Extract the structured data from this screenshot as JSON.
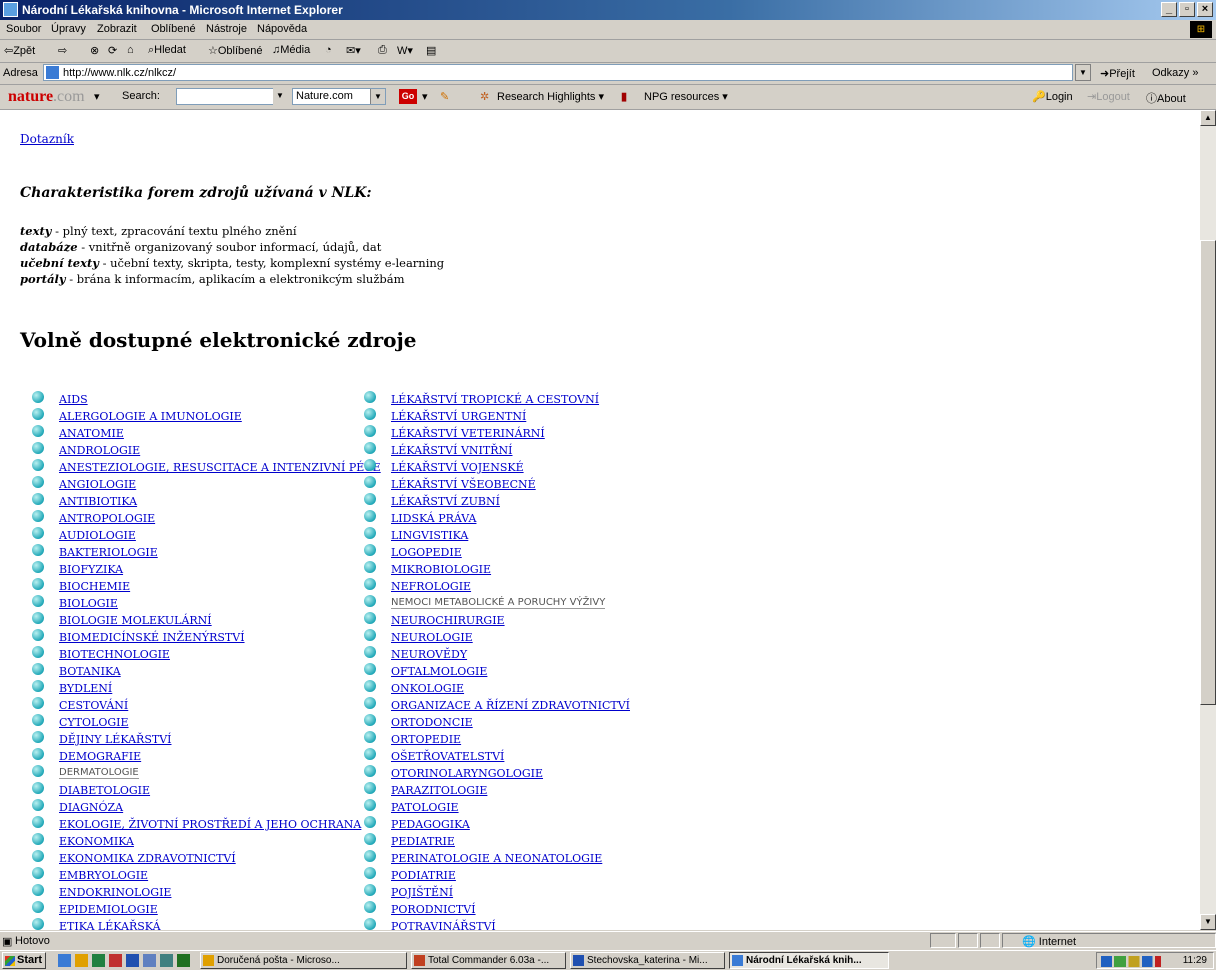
{
  "window": {
    "title": "Národní Lékařská knihovna - Microsoft Internet Explorer",
    "btn_min": "_",
    "btn_max": "▫",
    "btn_close": "×"
  },
  "menu": [
    "Soubor",
    "Úpravy",
    "Zobrazit",
    "Oblíbené",
    "Nástroje",
    "Nápověda"
  ],
  "toolbar": {
    "back": "⇦Zpět",
    "forward": "⇨",
    "search": "Hledat",
    "favorites": "Oblíbené",
    "media": "Média"
  },
  "address": {
    "label": "Adresa",
    "url": "http://www.nlk.cz/nlkcz/",
    "go": "Přejít",
    "links": "Odkazy"
  },
  "nature": {
    "logo": "nature",
    "logo_com": ".com",
    "search_label": "Search:",
    "scope": "Nature.com",
    "go": "Go",
    "highlights": "Research Highlights",
    "npg": "NPG resources",
    "login": "Login",
    "logout": "Logout",
    "about": "About"
  },
  "page": {
    "dotaznik": "Dotazník",
    "char_heading": "Charakteristika forem zdrojů užívaná v NLK:",
    "definitions": [
      {
        "term": "texty",
        "desc": " - plný text, zpracování textu plného znění"
      },
      {
        "term": "databáze",
        "desc": " - vnitřně organizovaný soubor informací, údajů, dat"
      },
      {
        "term": "učební texty",
        "desc": " - učební texty, skripta, testy, komplexní systémy e-learning"
      },
      {
        "term": "portály",
        "desc": " - brána k informacím, aplikacím a elektronikcým službám"
      }
    ],
    "main_heading": "Volně dostupné elektronické zdroje",
    "col1": [
      "AIDS",
      "ALERGOLOGIE A IMUNOLOGIE",
      "ANATOMIE",
      "ANDROLOGIE",
      "ANESTEZIOLOGIE, RESUSCITACE A INTENZIVNÍ PÉČE",
      "ANGIOLOGIE",
      "ANTIBIOTIKA",
      "ANTROPOLOGIE",
      "AUDIOLOGIE",
      "BAKTERIOLOGIE",
      "BIOFYZIKA",
      "BIOCHEMIE",
      "BIOLOGIE",
      "BIOLOGIE MOLEKULÁRNÍ",
      "BIOMEDICÍNSKÉ INŽENÝRSTVÍ",
      "BIOTECHNOLOGIE",
      "BOTANIKA",
      "BYDLENÍ",
      "CESTOVÁNÍ",
      "CYTOLOGIE",
      "DĚJINY LÉKAŘSTVÍ",
      "DEMOGRAFIE",
      "DERMATOLOGIE",
      "DIABETOLOGIE",
      "DIAGNÓZA",
      "EKOLOGIE, ŽIVOTNÍ PROSTŘEDÍ A JEHO OCHRANA",
      "EKONOMIKA",
      "EKONOMIKA ZDRAVOTNICTVÍ",
      "EMBRYOLOGIE",
      "ENDOKRINOLOGIE",
      "EPIDEMIOLOGIE",
      "ETIKA LÉKAŘSKÁ"
    ],
    "col2": [
      "LÉKAŘSTVÍ TROPICKÉ A CESTOVNÍ",
      "LÉKAŘSTVÍ URGENTNÍ",
      "LÉKAŘSTVÍ VETERINÁRNÍ",
      "LÉKAŘSTVÍ VNITŘNÍ",
      "LÉKAŘSTVÍ VOJENSKÉ",
      "LÉKAŘSTVÍ VŠEOBECNÉ",
      "LÉKAŘSTVÍ ZUBNÍ",
      "LIDSKÁ PRÁVA",
      "LINGVISTIKA",
      "LOGOPEDIE",
      "MIKROBIOLOGIE",
      "NEFROLOGIE",
      "NEMOCI METABOLICKÉ A PORUCHY VÝŽIVY",
      "NEUROCHIRURGIE",
      "NEUROLOGIE",
      "NEUROVĚDY",
      "OFTALMOLOGIE",
      "ONKOLOGIE",
      "ORGANIZACE A ŘÍZENÍ ZDRAVOTNICTVÍ",
      "ORTODONCIE",
      "ORTOPEDIE",
      "OŠETŘOVATELSTVÍ",
      "OTORINOLARYNGOLOGIE",
      "PARAZITOLOGIE",
      "PATOLOGIE",
      "PEDAGOGIKA",
      "PEDIATRIE",
      "PERINATOLOGIE A NEONATOLOGIE",
      "PODIATRIE",
      "POJIŠTĚNÍ",
      "PORODNICTVÍ",
      "POTRAVINÁŘSTVÍ"
    ],
    "plain_items": [
      "DERMATOLOGIE",
      "NEMOCI METABOLICKÉ A PORUCHY VÝŽIVY"
    ]
  },
  "status": {
    "text": "Hotovo",
    "zone": "Internet"
  },
  "taskbar": {
    "start": "Start",
    "tasks": [
      "Doručená pošta - Microso...",
      "Total Commander 6.03a -...",
      "Stechovska_katerina - Mi...",
      "Národní Lékařská knih..."
    ],
    "clock": "11:29"
  }
}
